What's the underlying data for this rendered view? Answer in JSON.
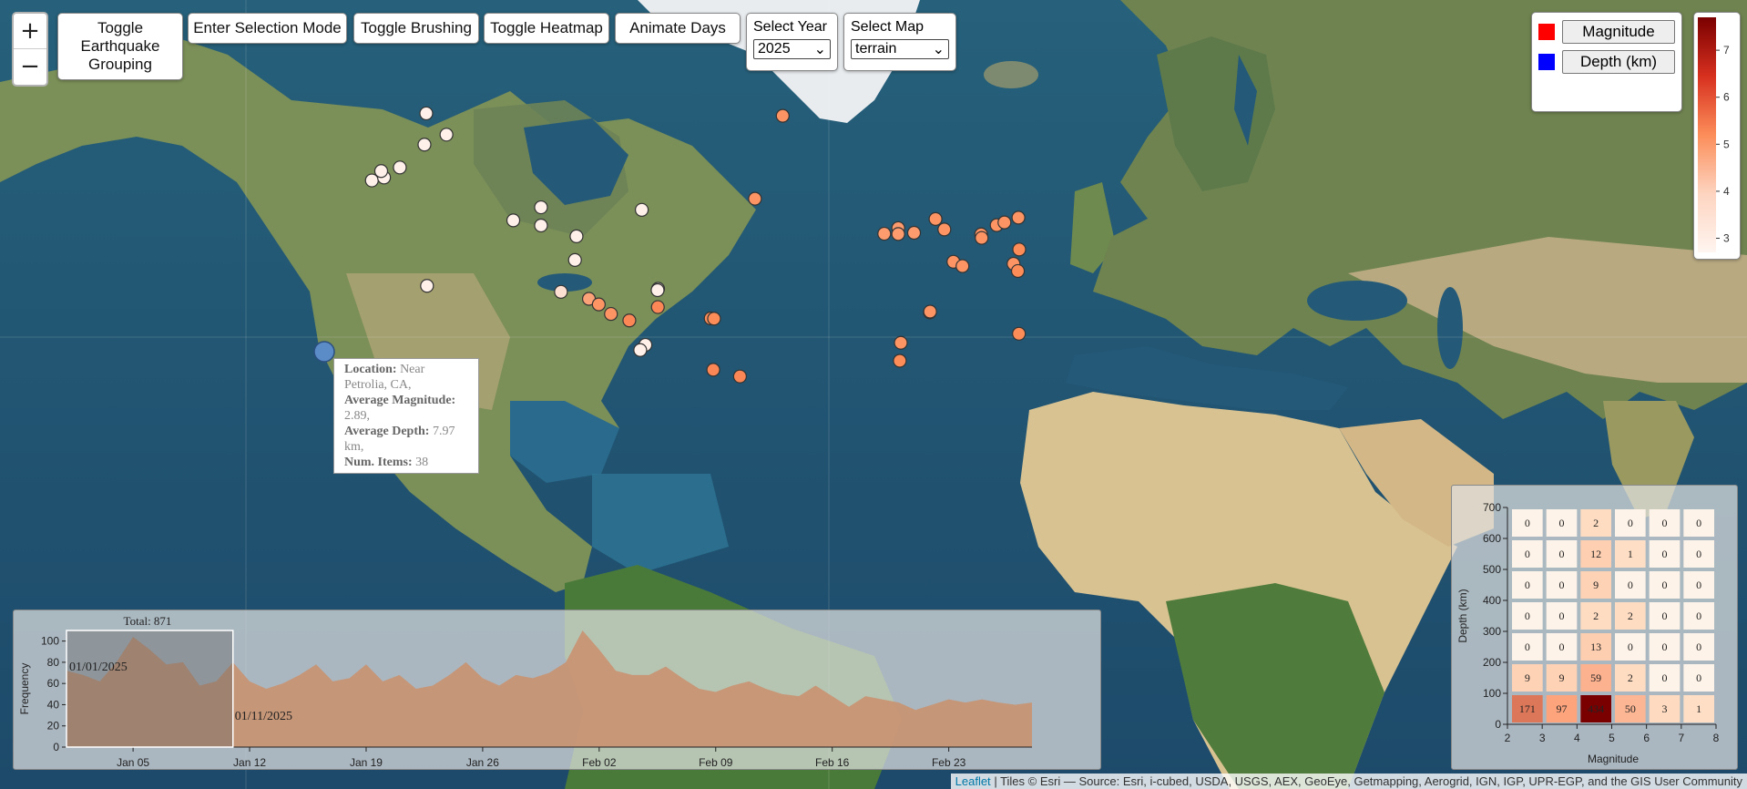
{
  "controls": {
    "zoom_in": "+",
    "zoom_out": "−",
    "toggle_grouping": "Toggle Earthquake Grouping",
    "selection_mode": "Enter Selection Mode",
    "toggle_brushing": "Toggle Brushing",
    "toggle_heatmap": "Toggle Heatmap",
    "animate_days": "Animate Days",
    "select_year_label": "Select Year",
    "select_year_value": "2025",
    "select_map_label": "Select Map",
    "select_map_value": "terrain"
  },
  "legend": {
    "items": [
      {
        "label": "Magnitude",
        "color": "#ff0000"
      },
      {
        "label": "Depth (km)",
        "color": "#0000ff"
      }
    ],
    "colorbar_ticks": [
      "7",
      "6",
      "5",
      "4",
      "3"
    ],
    "colorbar_range": [
      2.7,
      7.7
    ],
    "colorbar_colors": [
      "#7a0000",
      "#d7301f",
      "#fc8d59",
      "#fdd4c0",
      "#fff5f0"
    ]
  },
  "tooltip": {
    "location_label": "Location:",
    "location": "Near Petrolia, CA,",
    "avg_mag_label": "Average Magnitude:",
    "avg_mag": "2.89,",
    "avg_depth_label": "Average Depth:",
    "avg_depth": "7.97 km,",
    "num_items_label": "Num. Items:",
    "num_items": "38"
  },
  "timeline": {
    "total": "Total: 871",
    "ylabel": "Frequency",
    "brush_start": "01/01/2025",
    "brush_end": "01/11/2025",
    "yticks": [
      "0",
      "20",
      "40",
      "60",
      "80",
      "100"
    ],
    "xticks": [
      "Jan 05",
      "Jan 12",
      "Jan 19",
      "Jan 26",
      "Feb 02",
      "Feb 09",
      "Feb 16",
      "Feb 23"
    ]
  },
  "heatmap": {
    "xlabel": "Magnitude",
    "ylabel": "Depth (km)",
    "xticks": [
      "2",
      "3",
      "4",
      "5",
      "6",
      "7",
      "8"
    ],
    "yticks": [
      "0",
      "100",
      "200",
      "300",
      "400",
      "500",
      "600",
      "700"
    ]
  },
  "chart_data": [
    {
      "type": "area",
      "title": "Total: 871",
      "xlabel": "",
      "ylabel": "Frequency",
      "ylim": [
        0,
        110
      ],
      "x_start": "2025-01-01",
      "values": [
        72,
        68,
        62,
        80,
        104,
        92,
        78,
        80,
        58,
        62,
        80,
        62,
        55,
        60,
        68,
        78,
        62,
        65,
        78,
        62,
        68,
        55,
        58,
        68,
        80,
        65,
        58,
        68,
        65,
        70,
        80,
        110,
        92,
        72,
        68,
        68,
        76,
        65,
        55,
        52,
        58,
        62,
        55,
        50,
        48,
        58,
        48,
        38,
        48,
        45,
        42,
        35,
        40,
        45,
        42,
        45,
        42,
        40,
        42
      ],
      "brush": [
        "01/01/2025",
        "01/11/2025"
      ]
    },
    {
      "type": "heatmap",
      "xlabel": "Magnitude",
      "ylabel": "Depth (km)",
      "x_bins": [
        2,
        3,
        4,
        5,
        6,
        7,
        8
      ],
      "y_bins": [
        0,
        100,
        200,
        300,
        400,
        500,
        600,
        700
      ],
      "rows_top_to_bottom": [
        [
          0,
          0,
          2,
          0,
          0,
          0
        ],
        [
          0,
          0,
          12,
          1,
          0,
          0
        ],
        [
          0,
          0,
          9,
          0,
          0,
          0
        ],
        [
          0,
          0,
          2,
          2,
          0,
          0
        ],
        [
          0,
          0,
          13,
          0,
          0,
          0
        ],
        [
          9,
          9,
          59,
          2,
          0,
          0
        ],
        [
          171,
          97,
          434,
          50,
          3,
          1
        ]
      ]
    }
  ],
  "markers": [
    {
      "lon": -176.6,
      "lat": 51.6,
      "mag": 2.8
    },
    {
      "lon": -171.9,
      "lat": 52.3,
      "mag": 2.8
    },
    {
      "lon": -173.0,
      "lat": 53.8,
      "mag": 2.8
    },
    {
      "lon": -165.8,
      "lat": 54.6,
      "mag": 2.8
    },
    {
      "lon": -156.3,
      "lat": 59.4,
      "mag": 2.8
    },
    {
      "lon": -147.8,
      "lat": 61.3,
      "mag": 2.8
    },
    {
      "lon": -155.6,
      "lat": 65.0,
      "mag": 2.8
    },
    {
      "lon": -155.3,
      "lat": 19.4,
      "mag": 2.8
    },
    {
      "lon": -122.0,
      "lat": 41.0,
      "mag": 2.8
    },
    {
      "lon": -111.3,
      "lat": 44.7,
      "mag": 2.8
    },
    {
      "lon": -111.3,
      "lat": 39.5,
      "mag": 2.8
    },
    {
      "lon": -97.6,
      "lat": 36.2,
      "mag": 2.8
    },
    {
      "lon": -72.4,
      "lat": 44.0,
      "mag": 2.8
    },
    {
      "lon": -98.2,
      "lat": 28.5,
      "mag": 2.8
    },
    {
      "lon": -66.1,
      "lat": 18.3,
      "mag": 2.8
    },
    {
      "lon": -66.3,
      "lat": 17.8,
      "mag": 2.8
    },
    {
      "lon": -103.6,
      "lat": 17.2,
      "mag": 3.2
    },
    {
      "lon": -92.8,
      "lat": 14.6,
      "mag": 4.2
    },
    {
      "lon": -89.0,
      "lat": 12.5,
      "mag": 4.4
    },
    {
      "lon": -84.3,
      "lat": 8.9,
      "mag": 4.4
    },
    {
      "lon": -77.2,
      "lat": 6.4,
      "mag": 4.6
    },
    {
      "lon": -66.2,
      "lat": 11.5,
      "mag": 4.6
    },
    {
      "lon": -71.0,
      "lat": -3.0,
      "mag": 2.8
    },
    {
      "lon": -73.0,
      "lat": -5.0,
      "mag": 2.8
    },
    {
      "lon": -45.8,
      "lat": 7.2,
      "mag": 4.5
    },
    {
      "lon": -44.5,
      "lat": 7.1,
      "mag": 4.5
    },
    {
      "lon": -28.7,
      "lat": 47.0,
      "mag": 4.4
    },
    {
      "lon": -18.0,
      "lat": 64.6,
      "mag": 4.4
    },
    {
      "lon": 21.2,
      "lat": 37.0,
      "mag": 4.3
    },
    {
      "lon": 26.6,
      "lat": 38.7,
      "mag": 4.3
    },
    {
      "lon": 26.6,
      "lat": 36.9,
      "mag": 4.3
    },
    {
      "lon": 32.7,
      "lat": 37.3,
      "mag": 4.3
    },
    {
      "lon": 41.0,
      "lat": 41.4,
      "mag": 4.4
    },
    {
      "lon": 44.4,
      "lat": 38.3,
      "mag": 4.4
    },
    {
      "lon": 47.9,
      "lat": 27.9,
      "mag": 4.4
    },
    {
      "lon": 51.4,
      "lat": 26.4,
      "mag": 4.4
    },
    {
      "lon": 58.6,
      "lat": 36.8,
      "mag": 4.4
    },
    {
      "lon": 58.8,
      "lat": 35.7,
      "mag": 4.4
    },
    {
      "lon": 64.6,
      "lat": 39.6,
      "mag": 4.4
    },
    {
      "lon": 67.6,
      "lat": 40.4,
      "mag": 4.4
    },
    {
      "lon": 71.1,
      "lat": 27.2,
      "mag": 4.4
    },
    {
      "lon": 72.8,
      "lat": 24.7,
      "mag": 4.5
    },
    {
      "lon": 73.3,
      "lat": 32.0,
      "mag": 4.5
    },
    {
      "lon": 73.0,
      "lat": 41.8,
      "mag": 4.4
    },
    {
      "lon": 38.8,
      "lat": 9.5,
      "mag": 4.4
    },
    {
      "lon": 38.9,
      "lat": 9.8,
      "mag": 4.4
    },
    {
      "lon": 27.6,
      "lat": -2.2,
      "mag": 4.4
    },
    {
      "lon": 27.2,
      "lat": -9.1,
      "mag": 4.5
    },
    {
      "lon": 73.2,
      "lat": 1.3,
      "mag": 4.5
    },
    {
      "lon": -34.5,
      "lat": -15.0,
      "mag": 4.6
    },
    {
      "lon": -44.8,
      "lat": -12.5,
      "mag": 4.6
    }
  ],
  "attribution": {
    "leaflet": "Leaflet",
    "text": "| Tiles © Esri — Source: Esri, i-cubed, USDA, USGS, AEX, GeoEye, Getmapping, Aerogrid, IGN, IGP, UPR-EGP, and the GIS User Community"
  }
}
